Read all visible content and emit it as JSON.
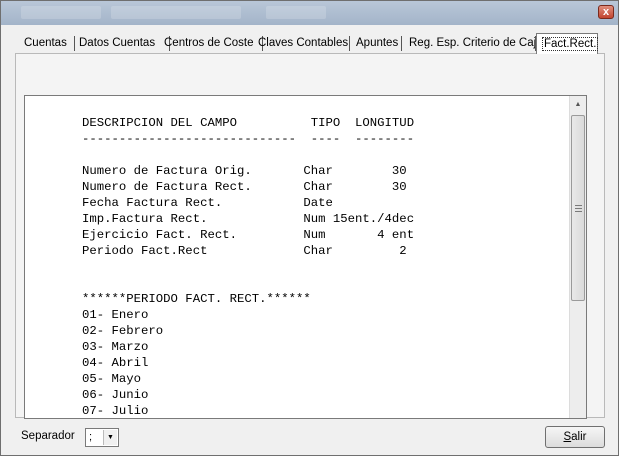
{
  "window": {
    "close_glyph": "x"
  },
  "tabs": [
    {
      "label": "Cuentas"
    },
    {
      "label": "Datos Cuentas"
    },
    {
      "label": "Centros de Coste"
    },
    {
      "label": "Claves Contables"
    },
    {
      "label": "Apuntes"
    },
    {
      "label": "Reg. Esp. Criterio de Caja"
    },
    {
      "label": "Fact.Rect."
    }
  ],
  "active_tab": "Fact.Rect.",
  "memo": {
    "lines": [
      "DESCRIPCION DEL CAMPO          TIPO  LONGITUD",
      "-----------------------------  ----  --------",
      "",
      "Numero de Factura Orig.       Char        30",
      "Numero de Factura Rect.       Char        30",
      "Fecha Factura Rect.           Date",
      "Imp.Factura Rect.             Num 15ent./4dec",
      "Ejercicio Fact. Rect.         Num       4 ent",
      "Periodo Fact.Rect             Char         2",
      "",
      "",
      "******PERIODO FACT. RECT.******",
      "01- Enero",
      "02- Febrero",
      "03- Marzo",
      "04- Abril",
      "05- Mayo",
      "06- Junio",
      "07- Julio"
    ]
  },
  "footer": {
    "separator_label": "Separador",
    "separator_value": ";",
    "exit_label": "Salir"
  }
}
